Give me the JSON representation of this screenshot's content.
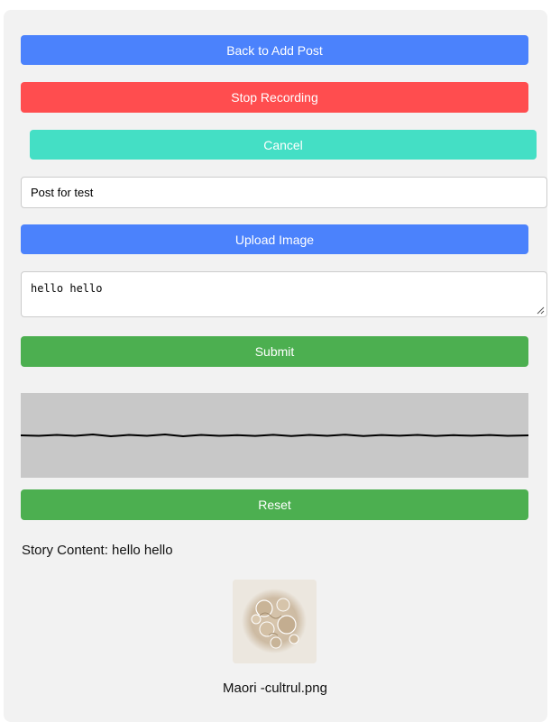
{
  "buttons": {
    "back_label": "Back to Add Post",
    "stop_label": "Stop Recording",
    "cancel_label": "Cancel",
    "upload_label": "Upload Image",
    "submit_label": "Submit",
    "reset_label": "Reset"
  },
  "form": {
    "title_value": "Post for test",
    "content_value": "hello hello"
  },
  "story": {
    "label": "Story Content: hello hello"
  },
  "image": {
    "filename": "Maori -cultrul.png"
  },
  "colors": {
    "blue": "#4b82fc",
    "red": "#ff4d4f",
    "teal": "#44dfc5",
    "green": "#4caf50",
    "panel": "#f2f2f2",
    "waveform_bg": "#c8c8c8"
  },
  "icons": {
    "resize_handle": "resize-grip-icon"
  }
}
